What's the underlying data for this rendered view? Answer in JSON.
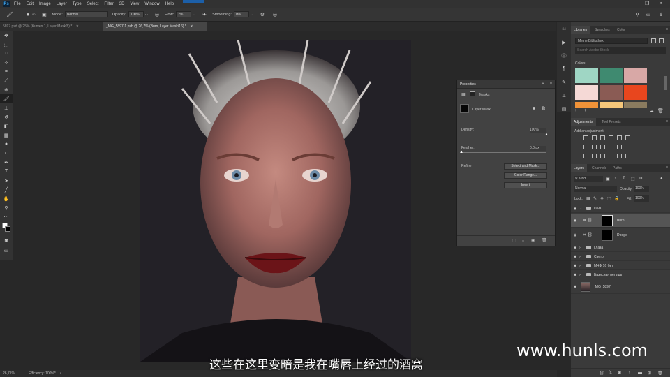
{
  "menu": {
    "items": [
      "File",
      "Edit",
      "Image",
      "Layer",
      "Type",
      "Select",
      "Filter",
      "3D",
      "View",
      "Window",
      "Help"
    ]
  },
  "options": {
    "brush_size": "80",
    "mode_label": "Mode:",
    "mode_value": "Normal",
    "opacity_label": "Opacity:",
    "opacity_value": "100%",
    "flow_label": "Flow:",
    "flow_value": "2%",
    "smoothing_label": "Smoothing:",
    "smoothing_value": "0%"
  },
  "tabs": [
    {
      "label": "5897.psd @ 25% (Kurven 1, Layer Mask/8) *"
    },
    {
      "label": "_MG_5897-1.psb @ 26,7% (Burn, Layer Mask/16) *"
    }
  ],
  "status": {
    "zoom": "26,71%",
    "efficiency": "Efficiency: 100%*"
  },
  "properties": {
    "title": "Properties",
    "section": "Masks",
    "mask_type": "Layer Mask",
    "density_label": "Density:",
    "density_value": "100%",
    "density_level": 1.0,
    "feather_label": "Feather:",
    "feather_value": "0,0 px",
    "feather_level": 0.0,
    "refine_label": "Refine:",
    "btn_select_mask": "Select and Mask...",
    "btn_color_range": "Color Range...",
    "btn_invert": "Invert"
  },
  "libraries": {
    "tabs": [
      "Libraries",
      "Swatches",
      "Color"
    ],
    "library_name": "Meine Bibliothek",
    "search_placeholder": "Search Adobe Stock",
    "colors_label": "Colors",
    "swatch_colors": [
      "#9fd6c4",
      "#3f8a70",
      "#d8a8a6",
      "#f5d9d6",
      "#8a5b54",
      "#e8461e",
      "#f09238",
      "#f5c77a",
      "#8a7b5f"
    ]
  },
  "adjustments": {
    "tabs": [
      "Adjustments",
      "Tool Presets"
    ],
    "add_label": "Add an adjustment"
  },
  "layers": {
    "tabs": [
      "Layers",
      "Channels",
      "Paths"
    ],
    "kind_label": "Kind",
    "blend_mode": "Normal",
    "opacity_label": "Opacity:",
    "opacity_value": "100%",
    "lock_label": "Lock:",
    "fill_label": "Fill:",
    "fill_value": "100%",
    "items": [
      {
        "name": "D&B",
        "type": "group",
        "expanded": true
      },
      {
        "name": "Burn",
        "type": "layer",
        "selected": true
      },
      {
        "name": "Dodge",
        "type": "layer"
      },
      {
        "name": "Глаза",
        "type": "group"
      },
      {
        "name": "Свето",
        "type": "group"
      },
      {
        "name": "МЧФ 16 бит",
        "type": "group"
      },
      {
        "name": "Базисная ретушь",
        "type": "group"
      },
      {
        "name": "_MG_5897",
        "type": "image"
      }
    ]
  },
  "overlay": {
    "watermark": "www.hunls.com",
    "subtitle": "这些在这里变暗是我在嘴唇上经过的酒窝"
  },
  "colors": {
    "accent_blue": "#1c5fa8",
    "panel_bg": "#3a3a3a",
    "canvas_bg": "#282828"
  }
}
